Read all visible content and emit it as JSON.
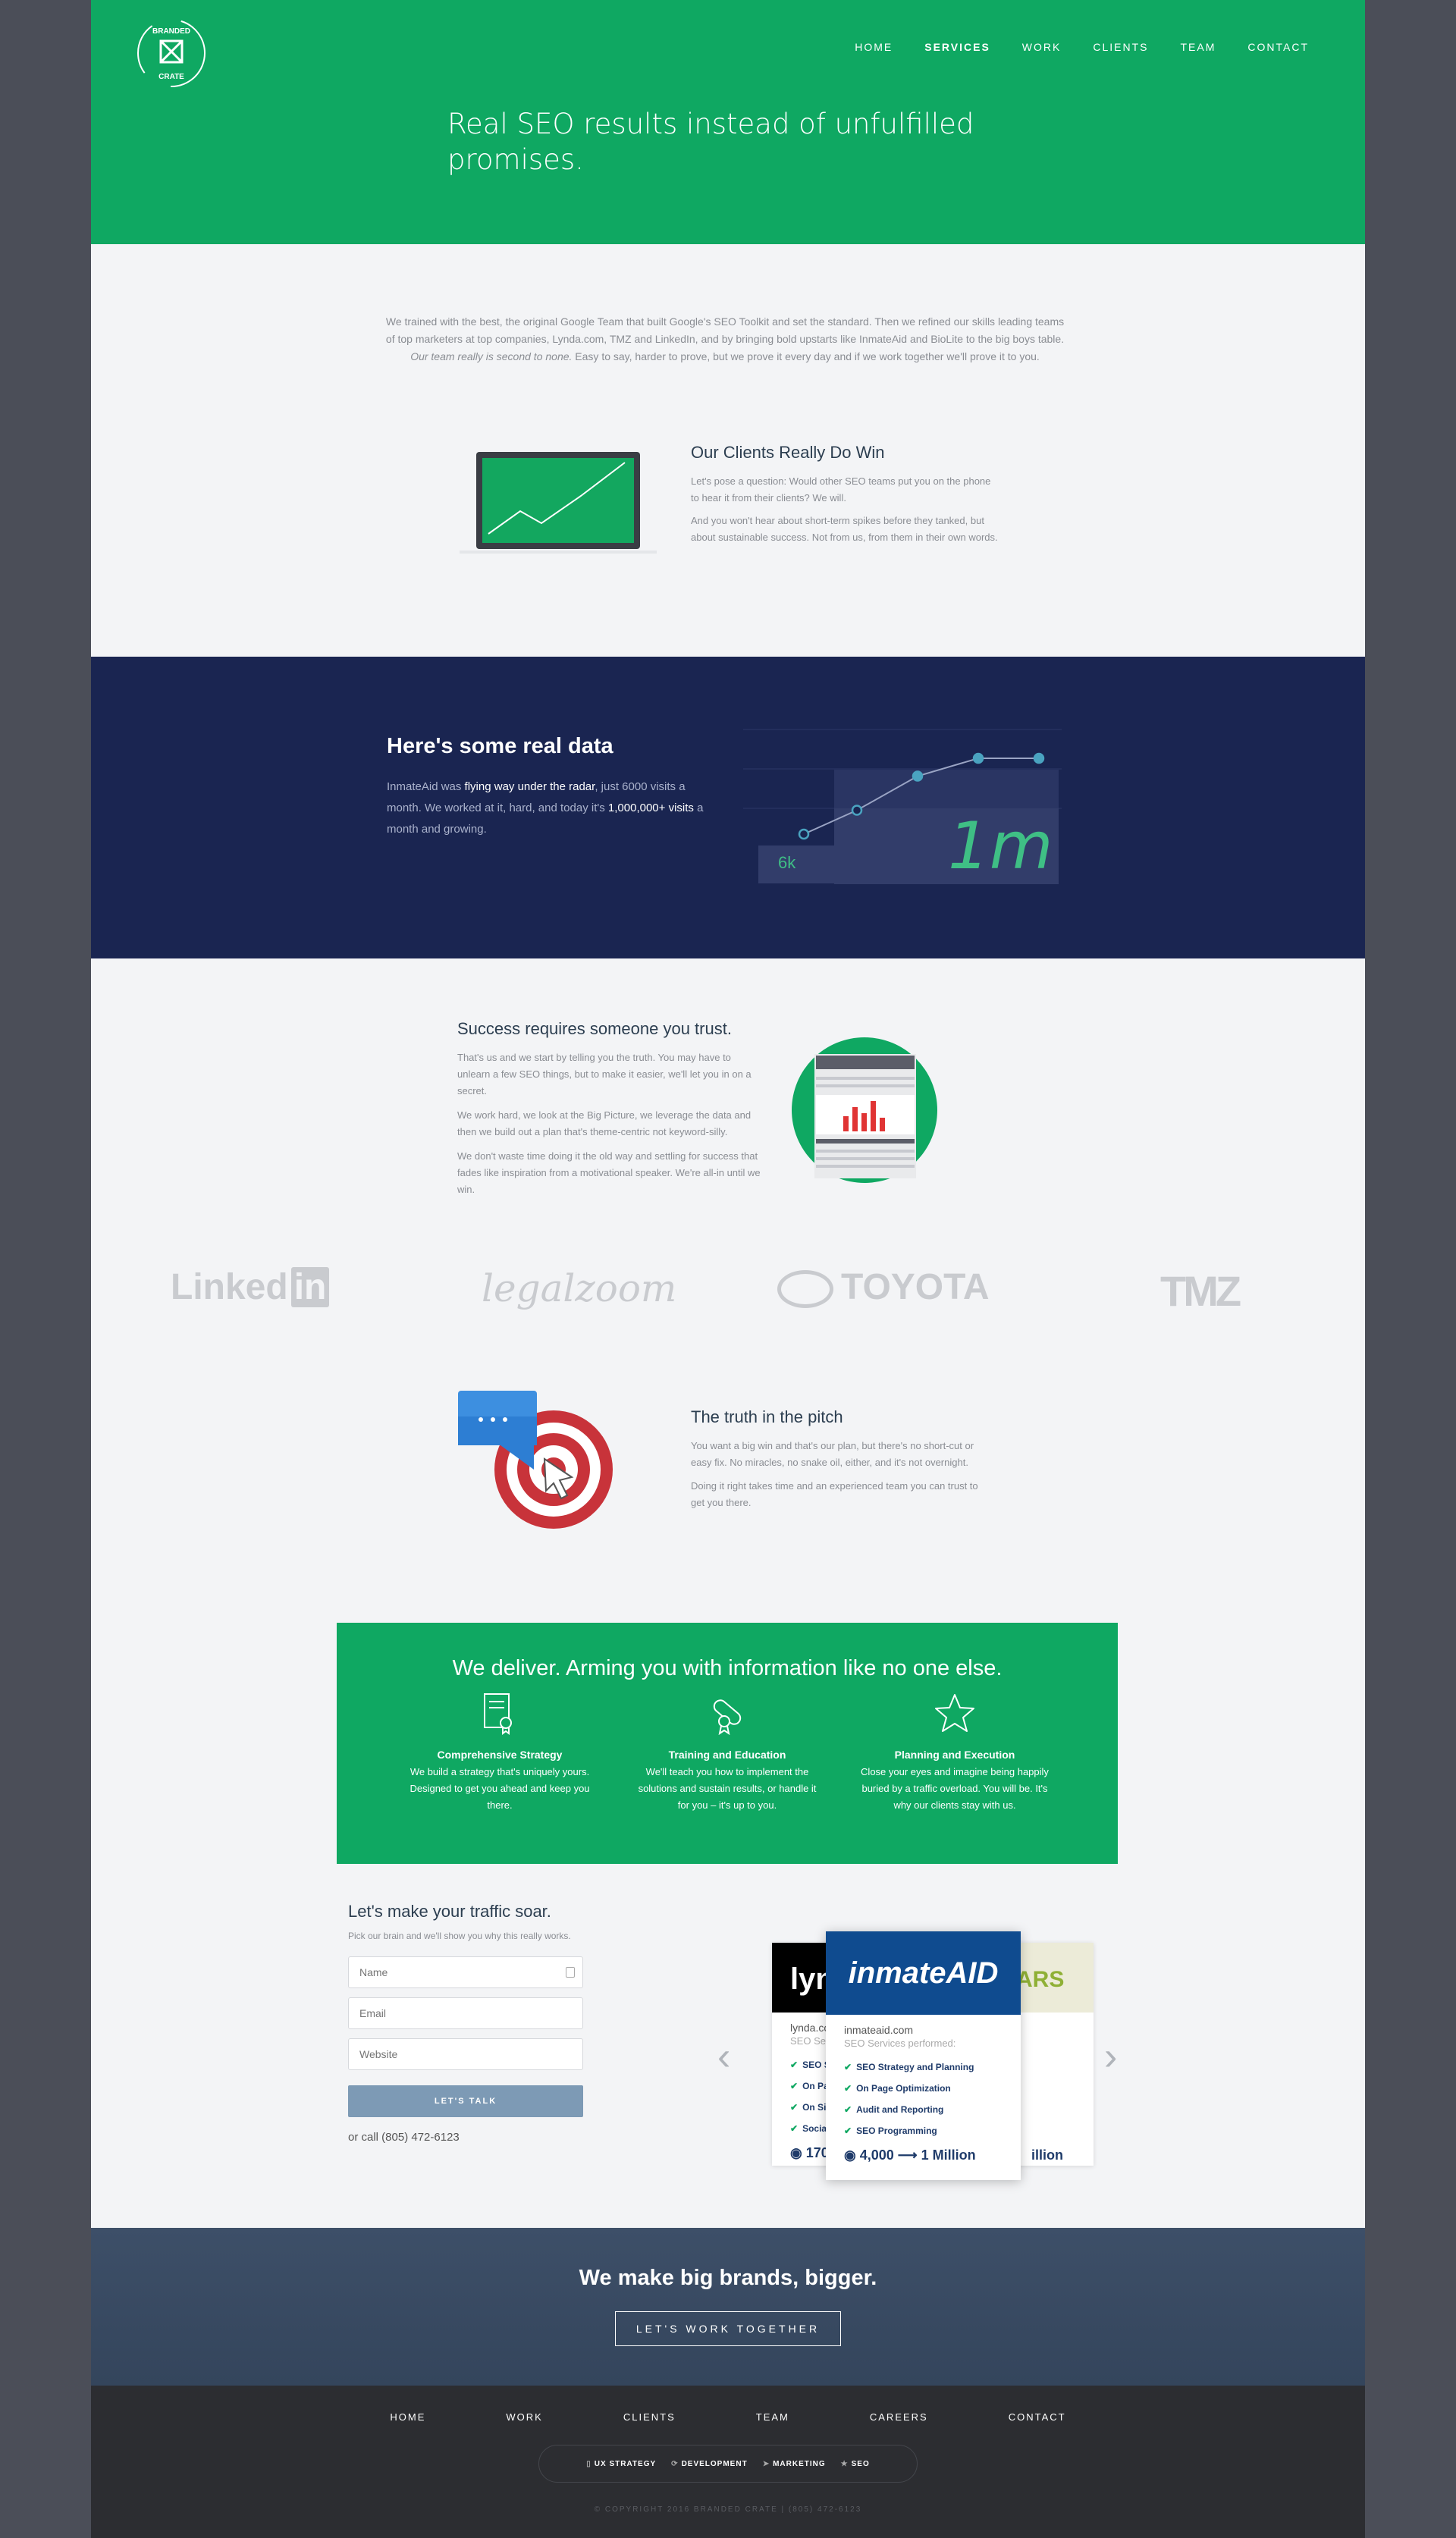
{
  "nav": {
    "items": [
      "HOME",
      "SERVICES",
      "WORK",
      "CLIENTS",
      "TEAM",
      "CONTACT"
    ],
    "active": "SERVICES"
  },
  "logo": {
    "text_top": "BRANDED",
    "text_bottom": "CRATE"
  },
  "hero": {
    "title": "Real SEO results instead of unfulfilled promises."
  },
  "intro": {
    "text_a": "We trained with the best, the original Google Team that built Google's SEO Toolkit and set the standard. Then we refined our skills leading teams of top marketers at top companies, Lynda.com, TMZ and LinkedIn, and by bringing bold upstarts like InmateAid and BioLite to the big boys table. ",
    "text_em": "Our team really is second to none.",
    "text_b": " Easy to say, harder to prove, but we prove it every day and if we work together we'll prove it to you."
  },
  "clients": {
    "title": "Our Clients Really Do Win",
    "p1": "Let's pose a question: Would other SEO teams put you on the phone to hear it from their clients? We will.",
    "p2": "And you won't hear about short-term spikes before they tanked, but about sustainable success. Not from us, from them in their own words."
  },
  "data_section": {
    "title": "Here's some real data",
    "t1": "InmateAid was ",
    "t1b": "flying way under the radar",
    "t2": ", just 6000 visits a month. We worked at it, hard, and today it's ",
    "t2b": "1,000,000+ visits",
    "t3": " a month and growing.",
    "chart_low_label": "6k",
    "chart_high_label": "1m"
  },
  "chart_data": {
    "type": "line",
    "title": "",
    "labels": [
      "6k",
      "1m"
    ],
    "series": [
      {
        "values": [
          6000,
          30000,
          300000,
          1000000,
          1000000
        ]
      }
    ]
  },
  "success": {
    "title": "Success requires someone you trust.",
    "p1": "That's us and we start by telling you the truth. You may have to unlearn a few SEO things, but to make it easier, we'll let you in on a secret.",
    "p2": "We work hard, we look at the Big Picture, we leverage the data and then we build out a plan that's theme-centric not keyword-silly.",
    "p3": "We don't waste time doing it the old way and settling for success that fades like inspiration from a motivational speaker. We're all-in until we win."
  },
  "brands": [
    "Linked",
    "legalzoom",
    "TOYOTA",
    "TMZ"
  ],
  "brand_linkedin_in": "in",
  "truth": {
    "title": "The truth in the pitch",
    "p1": "You want a big win and that's our plan, but there's no short-cut or easy fix. No miracles, no snake oil, either, and it's not overnight.",
    "p2": "Doing it right takes time and an experienced team you can trust to get you there."
  },
  "deliver": {
    "title": "We deliver. Arming you with information like no one else.",
    "features": [
      {
        "title": "Comprehensive Strategy",
        "desc": "We build a strategy that's uniquely yours. Designed to get you ahead and keep you there.",
        "icon": "certificate-icon"
      },
      {
        "title": "Training and Education",
        "desc": "We'll teach you how to implement the solutions and sustain results, or handle it for you – it's up to you.",
        "icon": "diploma-icon"
      },
      {
        "title": "Planning and Execution",
        "desc": "Close your eyes and imagine being happily buried by a traffic overload. You will be. It's why our clients stay with us.",
        "icon": "star-icon"
      }
    ]
  },
  "form": {
    "title": "Let's make your traffic soar.",
    "subtitle": "Pick our brain and we'll show you why this really works.",
    "name_placeholder": "Name",
    "email_placeholder": "Email",
    "website_placeholder": "Website",
    "submit": "LET'S TALK",
    "call": "or call (805) 472-6123"
  },
  "cards": {
    "left": {
      "logo": "lyn",
      "domain": "lynda.com",
      "sub": "SEO Servic",
      "items": [
        "SEO S",
        "On Pa",
        "On Sit",
        "Social"
      ],
      "result": "170"
    },
    "center": {
      "logo": "inmateAID",
      "domain": "inmateaid.com",
      "sub": "SEO Services performed:",
      "items": [
        "SEO Strategy and Planning",
        "On Page Optimization",
        "Audit and Reporting",
        "SEO Programming"
      ],
      "result_from": "4,000",
      "result_to": "1 Million"
    },
    "right": {
      "logo": "ARS",
      "result": "illion"
    }
  },
  "cta": {
    "title": "We make big brands, bigger.",
    "button": "LET'S WORK TOGETHER"
  },
  "footer": {
    "nav": [
      "HOME",
      "WORK",
      "CLIENTS",
      "TEAM",
      "CAREERS",
      "CONTACT"
    ],
    "services": [
      "UX STRATEGY",
      "DEVELOPMENT",
      "MARKETING",
      "SEO"
    ],
    "copyright": "© COPYRIGHT 2016 BRANDED CRATE | (805) 472-6123"
  },
  "colors": {
    "green": "#0fa862",
    "navy": "#1a2551",
    "slate": "#3d4f68",
    "footer": "#2c2d31",
    "accent_blue": "#4aa3c0"
  }
}
